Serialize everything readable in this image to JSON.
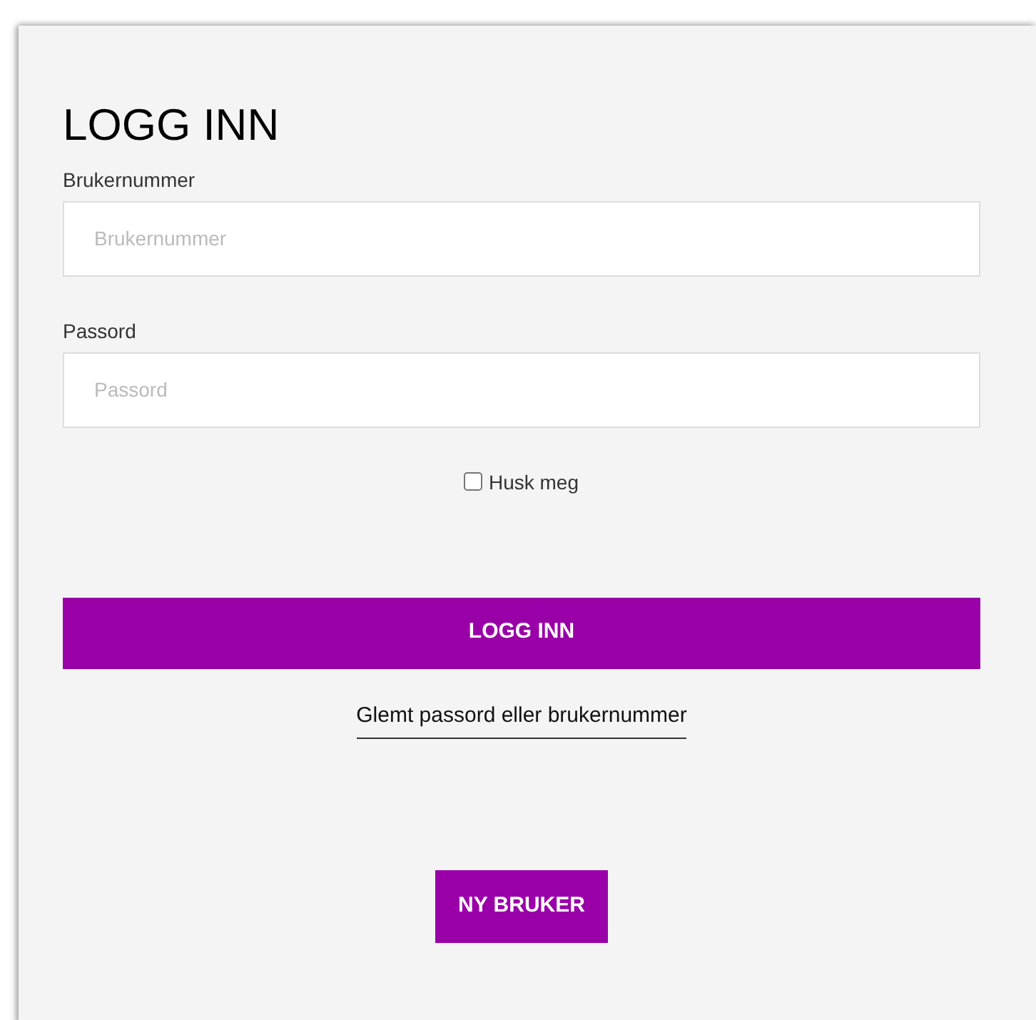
{
  "title": "LOGG INN",
  "fields": [
    {
      "label": "Brukernummer",
      "placeholder": "Brukernummer"
    },
    {
      "label": "Passord",
      "placeholder": "Passord"
    }
  ],
  "remember": {
    "label": "Husk meg",
    "checked": false
  },
  "submit": "LOGG INN",
  "forgot_link": "Glemt passord eller brukernummer",
  "register": "NY BRUKER"
}
